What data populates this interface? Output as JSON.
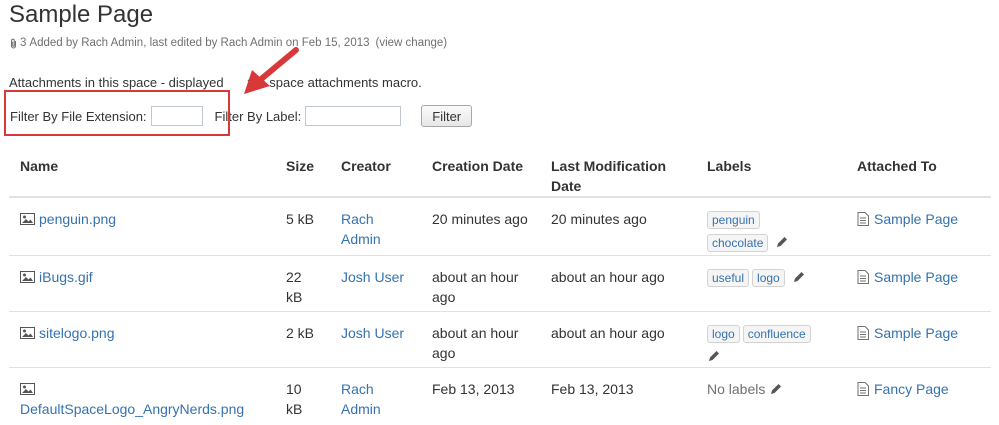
{
  "page": {
    "title": "Sample Page",
    "attachment_count": "3",
    "meta_text": "Added by Rach Admin, last edited by Rach Admin on Feb 15, 2013",
    "view_change": "(view change)"
  },
  "description": {
    "before": "Attachments in this space - displayed",
    "after": "the space attachments macro."
  },
  "filter": {
    "extension_label": "Filter By File Extension:",
    "extension_value": "",
    "label_label": "Filter By Label:",
    "label_value": "",
    "button_label": "Filter"
  },
  "table": {
    "headers": {
      "name": "Name",
      "size": "Size",
      "creator": "Creator",
      "creation_date": "Creation Date",
      "last_modification_date": "Last Modification Date",
      "labels": "Labels",
      "attached_to": "Attached To"
    },
    "rows": [
      {
        "name": "penguin.png",
        "size": "5 kB",
        "creator": "Rach Admin",
        "creation_date": "20 minutes ago",
        "modified_date": "20 minutes ago",
        "labels": [
          "penguin",
          "chocolate"
        ],
        "attached_to": "Sample Page"
      },
      {
        "name": "iBugs.gif",
        "size": "22 kB",
        "creator": "Josh User",
        "creation_date": "about an hour ago",
        "modified_date": "about an hour ago",
        "labels": [
          "useful",
          "logo"
        ],
        "attached_to": "Sample Page"
      },
      {
        "name": "sitelogo.png",
        "size": "2 kB",
        "creator": "Josh User",
        "creation_date": "about an hour ago",
        "modified_date": "about an hour ago",
        "labels": [
          "logo",
          "confluence"
        ],
        "attached_to": "Sample Page"
      },
      {
        "name": "DefaultSpaceLogo_AngryNerds.png",
        "size": "10 kB",
        "creator": "Rach Admin",
        "creation_date": "Feb 13, 2013",
        "modified_date": "Feb 13, 2013",
        "labels": [],
        "no_labels_text": "No labels",
        "attached_to": "Fancy Page"
      }
    ]
  },
  "icons": {
    "attachment": "paperclip-icon",
    "file": "image-file-icon",
    "page": "page-icon",
    "edit_labels": "pencil-icon"
  },
  "colors": {
    "link": "#3572b0",
    "annotation": "#d9383a",
    "meta": "#707070"
  }
}
